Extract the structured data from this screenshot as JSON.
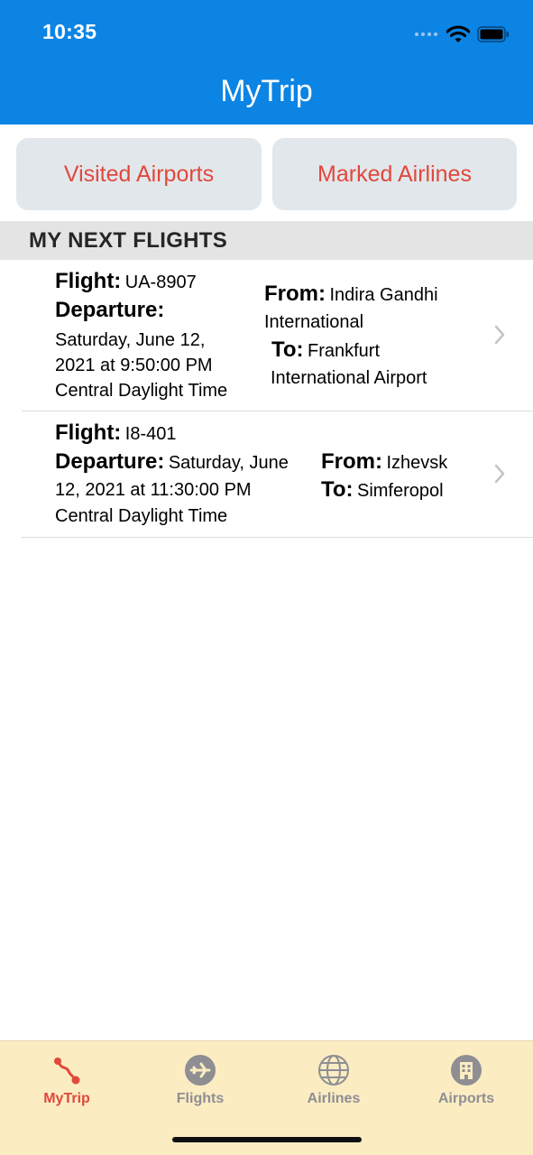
{
  "status_bar": {
    "time": "10:35"
  },
  "nav": {
    "title": "MyTrip"
  },
  "buttons": {
    "visited": "Visited Airports",
    "marked": "Marked Airlines"
  },
  "section": {
    "title": "MY NEXT FLIGHTS"
  },
  "labels": {
    "flight": "Flight:",
    "departure": "Departure:",
    "from": "From:",
    "to": "To:"
  },
  "flights": [
    {
      "flight": "UA-8907",
      "departure_line1": "Saturday, June 12,",
      "departure_line2": "2021 at 9:50:00 PM",
      "departure_line3": "Central Daylight Time",
      "from_line1": "Indira Gandhi",
      "from_line2": "International",
      "to_line1": "Frankfurt",
      "to_line2": "International Airport"
    },
    {
      "flight": "I8-401",
      "departure_line1": "Saturday, June",
      "departure_line2": "12, 2021 at 11:30:00 PM",
      "departure_line3": "Central Daylight Time",
      "from": "Izhevsk",
      "to": "Simferopol"
    }
  ],
  "tabs": [
    {
      "label": "MyTrip",
      "icon": "route-icon",
      "active": true
    },
    {
      "label": "Flights",
      "icon": "airplane-icon",
      "active": false
    },
    {
      "label": "Airlines",
      "icon": "globe-icon",
      "active": false
    },
    {
      "label": "Airports",
      "icon": "building-icon",
      "active": false
    }
  ],
  "colors": {
    "header": "#0b84e4",
    "accent": "#e1483c",
    "tabbar": "#fbecc2",
    "inactive_tab": "#8e8e93"
  }
}
